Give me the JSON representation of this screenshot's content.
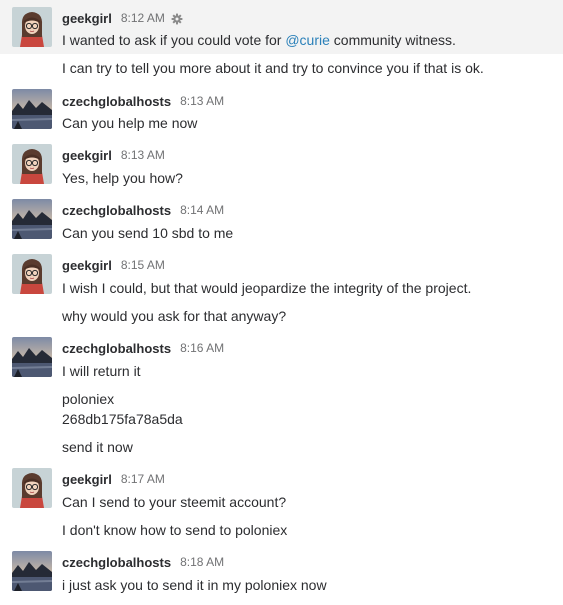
{
  "messages": [
    {
      "user": "geekgirl",
      "time": "8:12 AM",
      "avatar": "geekgirl-avatar",
      "lines": [
        {
          "pre": "I wanted to ask if you could vote for ",
          "mention": "@curie",
          "post": " community witness."
        },
        {
          "text": "I can try to tell you more about it and try to convince you if that is ok."
        }
      ]
    },
    {
      "user": "czechglobalhosts",
      "time": "8:13 AM",
      "avatar": "lake-avatar",
      "lines": [
        {
          "text": "Can you help me now"
        }
      ]
    },
    {
      "user": "geekgirl",
      "time": "8:13 AM",
      "avatar": "geekgirl-avatar",
      "lines": [
        {
          "text": "Yes, help you how?"
        }
      ]
    },
    {
      "user": "czechglobalhosts",
      "time": "8:14 AM",
      "avatar": "lake-avatar",
      "lines": [
        {
          "text": "Can you send 10 sbd to me"
        }
      ]
    },
    {
      "user": "geekgirl",
      "time": "8:15 AM",
      "avatar": "geekgirl-avatar",
      "lines": [
        {
          "text": "I wish I could, but that would jeopardize the integrity of the project."
        },
        {
          "text": "why would you ask for that anyway?"
        }
      ]
    },
    {
      "user": "czechglobalhosts",
      "time": "8:16 AM",
      "avatar": "lake-avatar",
      "lines": [
        {
          "text": "I will return it"
        },
        {
          "text": "poloniex"
        },
        {
          "text": "268db175fa78a5da"
        },
        {
          "text": "send it now"
        }
      ]
    },
    {
      "user": "geekgirl",
      "time": "8:17 AM",
      "avatar": "geekgirl-avatar",
      "lines": [
        {
          "text": "Can I send to your steemit account?"
        },
        {
          "text": "I don't know how to send to poloniex"
        }
      ]
    },
    {
      "user": "czechglobalhosts",
      "time": "8:18 AM",
      "avatar": "lake-avatar",
      "lines": [
        {
          "text": "i just ask you to send it in my poloniex now"
        }
      ]
    }
  ],
  "icons": {
    "message_actions": "gear-icon"
  },
  "colors": {
    "hover_background": "#f3f3f3",
    "mention": "#2a80b9",
    "username": "#2c2d30",
    "timestamp": "#717274"
  }
}
